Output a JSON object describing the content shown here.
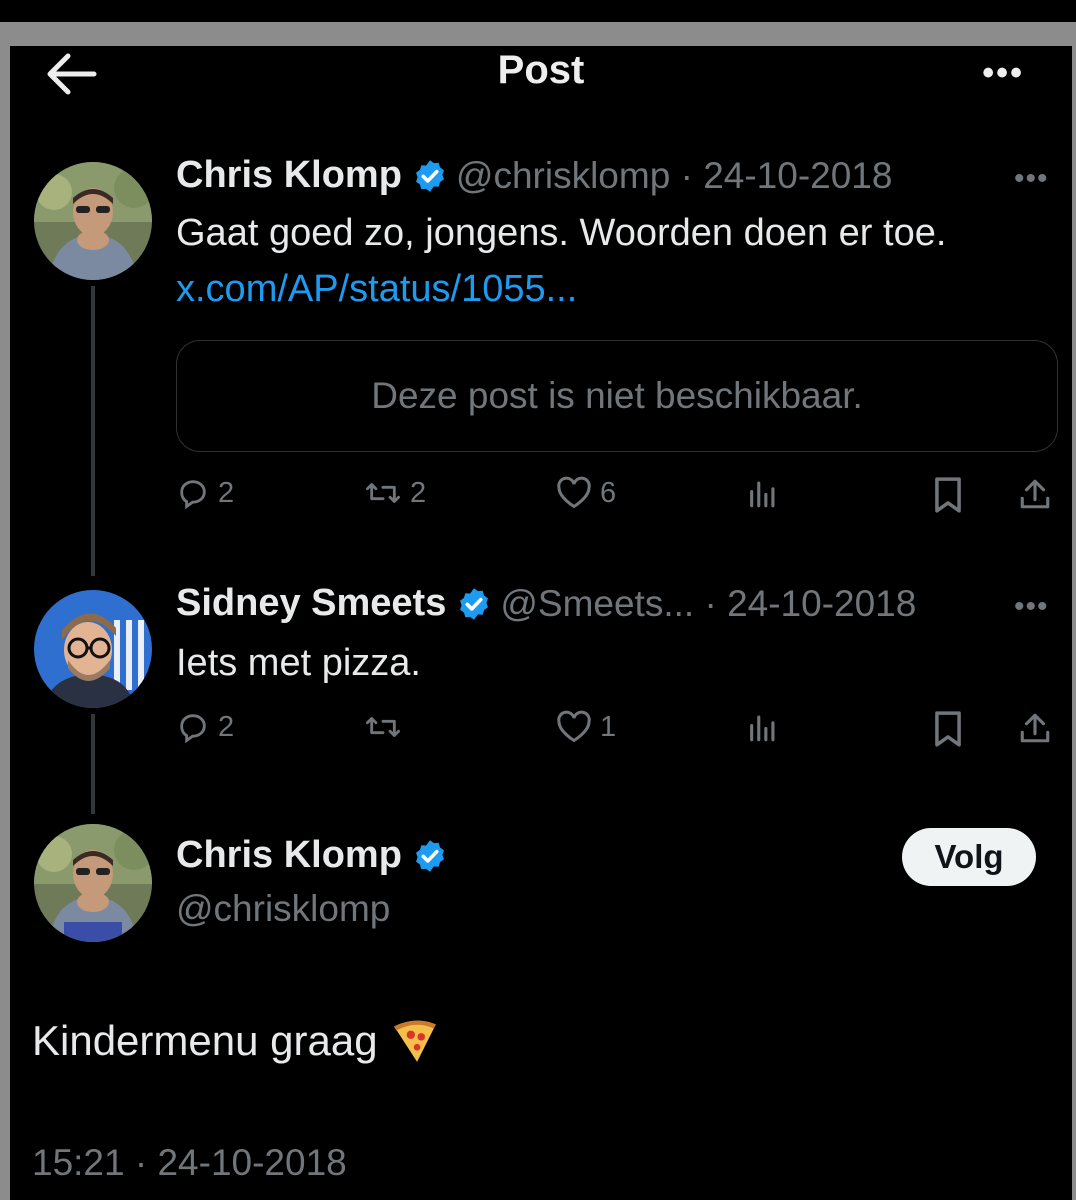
{
  "header": {
    "title": "Post"
  },
  "tweets": [
    {
      "name": "Chris Klomp",
      "handle": "@chrisklomp",
      "date": "24-10-2018",
      "text": "Gaat goed zo, jongens. Woorden doen er toe.",
      "link": "x.com/AP/status/1055...",
      "quote_unavailable": "Deze post is niet beschikbaar.",
      "replies": "2",
      "reposts": "2",
      "likes": "6"
    },
    {
      "name": "Sidney Smeets",
      "handle": "@Smeets...",
      "date": "24-10-2018",
      "text": "Iets met pizza.",
      "replies": "2",
      "reposts": "",
      "likes": "1"
    }
  ],
  "main_post": {
    "name": "Chris Klomp",
    "handle": "@chrisklomp",
    "follow_label": "Volg",
    "text": "Kindermenu graag",
    "timestamp": "15:21 · 24-10-2018"
  },
  "icons": [
    "back-arrow-icon",
    "more-icon",
    "verified-badge-icon",
    "reply-icon",
    "repost-icon",
    "like-icon",
    "analytics-icon",
    "bookmark-icon",
    "share-icon",
    "pizza-emoji"
  ],
  "colors": {
    "background": "#000000",
    "accent": "#1d9bf0",
    "muted": "#71767b",
    "text": "#e7e9ea"
  }
}
